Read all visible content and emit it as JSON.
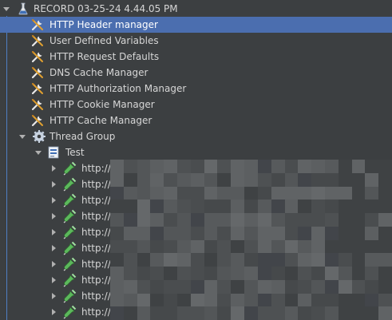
{
  "tree": {
    "root": {
      "label": "RECORD 03-25-24 4.44.05 PM",
      "icon": "flask-icon"
    },
    "config_elements": [
      {
        "label": "HTTP Header manager",
        "selected": true
      },
      {
        "label": "User Defined Variables"
      },
      {
        "label": "HTTP Request Defaults"
      },
      {
        "label": "DNS Cache Manager"
      },
      {
        "label": "HTTP Authorization Manager"
      },
      {
        "label": "HTTP Cookie Manager"
      },
      {
        "label": "HTTP Cache Manager"
      }
    ],
    "thread_group": {
      "label": "Thread Group",
      "icon": "gear-icon"
    },
    "controller": {
      "label": "Test",
      "icon": "transaction-controller-icon"
    },
    "samplers": [
      {
        "label": "http://"
      },
      {
        "label": "http://"
      },
      {
        "label": "http://"
      },
      {
        "label": "http://"
      },
      {
        "label": "http://"
      },
      {
        "label": "http://"
      },
      {
        "label": "http://"
      },
      {
        "label": "http://"
      },
      {
        "label": "http://"
      },
      {
        "label": "http://"
      }
    ]
  },
  "colors": {
    "background": "#3c3f41",
    "selection": "#4b6eaf",
    "text": "#d6d6d6",
    "tree_guide": "#4f7fc4"
  }
}
